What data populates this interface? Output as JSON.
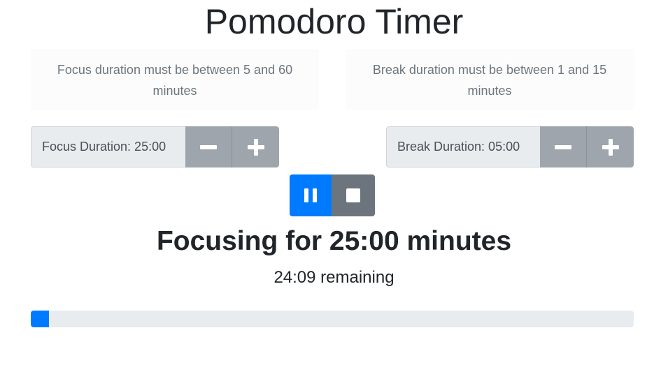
{
  "title": "Pomodoro Timer",
  "notices": {
    "focus": "Focus duration must be between 5 and 60 minutes",
    "break": "Break duration must be between 1 and 15 minutes"
  },
  "focus_control": {
    "label": "Focus Duration: 25:00",
    "decrement_icon": "minus-icon",
    "increment_icon": "plus-icon"
  },
  "break_control": {
    "label": "Break Duration: 05:00",
    "decrement_icon": "minus-icon",
    "increment_icon": "plus-icon"
  },
  "playback": {
    "pause_icon": "pause-icon",
    "stop_icon": "stop-icon"
  },
  "status": "Focusing for 25:00 minutes",
  "remaining": "24:09 remaining",
  "progress_fraction": 0.0307,
  "colors": {
    "primary": "#007bff",
    "secondary": "#6c757d",
    "stepper_button": "#9ea5ad",
    "track": "#e9ecef"
  }
}
